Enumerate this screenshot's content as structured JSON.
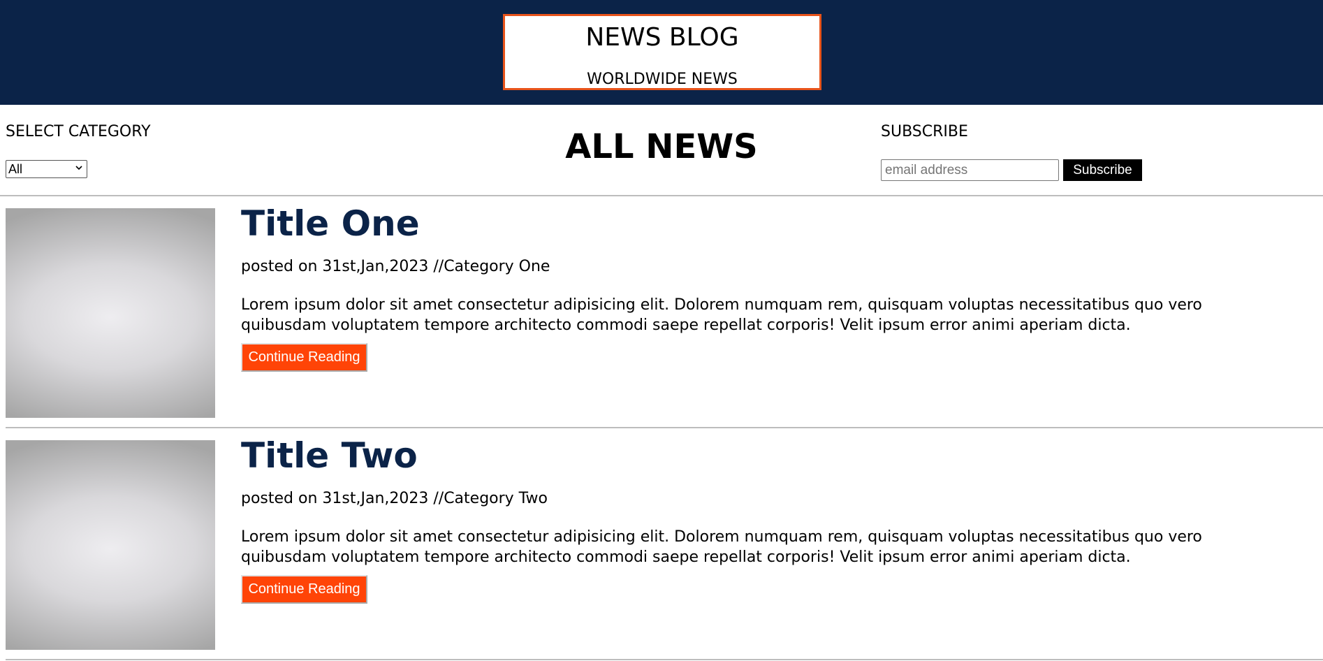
{
  "brand": {
    "title": "NEWS BLOG",
    "subtitle": "WORLDWIDE NEWS"
  },
  "category": {
    "label": "SELECT CATEGORY",
    "selected": "All"
  },
  "page": {
    "heading": "ALL NEWS"
  },
  "subscribe": {
    "label": "SUBSCRIBE",
    "placeholder": "email address",
    "button": "Subscribe"
  },
  "posts": [
    {
      "title": "Title One",
      "meta": "posted on 31st,Jan,2023 //Category One",
      "excerpt": "Lorem ipsum dolor sit amet consectetur adipisicing elit. Dolorem numquam rem, quisquam voluptas necessitatibus quo vero quibusdam voluptatem tempore architecto commodi saepe repellat corporis! Velit ipsum error animi aperiam dicta.",
      "cta": "Continue Reading"
    },
    {
      "title": "Title Two",
      "meta": "posted on 31st,Jan,2023 //Category Two",
      "excerpt": "Lorem ipsum dolor sit amet consectetur adipisicing elit. Dolorem numquam rem, quisquam voluptas necessitatibus quo vero quibusdam voluptatem tempore architecto commodi saepe repellat corporis! Velit ipsum error animi aperiam dicta.",
      "cta": "Continue Reading"
    }
  ],
  "colors": {
    "header_bg": "#0b2348",
    "accent": "#ff4407",
    "logo_border": "#e8541b",
    "title_color": "#0b2348"
  }
}
